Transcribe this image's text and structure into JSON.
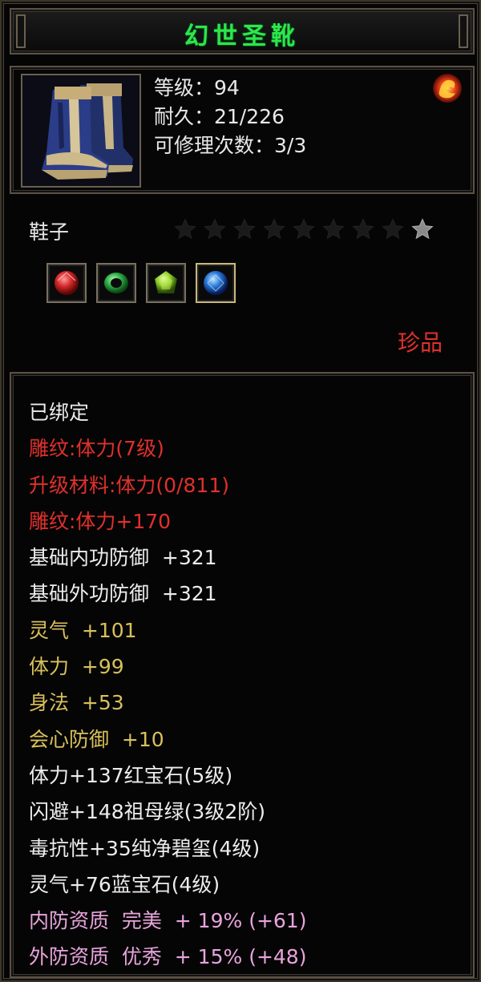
{
  "item": {
    "name": "幻世圣靴",
    "level_line": "等级：94",
    "durability_line": "耐久：21/226",
    "repair_line": "可修理次数：3/3",
    "type": "鞋子",
    "rarity": "珍品",
    "stars": {
      "total": 9,
      "lit": 1
    }
  },
  "gems": [
    {
      "name": "red-gem-icon",
      "color": "#d42a2a"
    },
    {
      "name": "emerald-ring-icon",
      "color": "#2fb24a"
    },
    {
      "name": "green-jade-icon",
      "color": "#8fd12a"
    },
    {
      "name": "blue-sapphire-icon",
      "color": "#2a7ad8"
    }
  ],
  "colors": {
    "title": "#2fe64a",
    "white": "#ececec",
    "red": "#e0302c",
    "gold": "#d8c05a",
    "pink": "#e8a4dc"
  },
  "stats": [
    {
      "text": "已绑定",
      "color": "#ececec"
    },
    {
      "text": "雕纹:体力(7级)",
      "color": "#e0302c"
    },
    {
      "text": "升级材料:体力(0/811)",
      "color": "#e0302c"
    },
    {
      "text": "雕纹:体力+170",
      "color": "#e0302c"
    },
    {
      "text": "基础内功防御  +321",
      "color": "#ececec"
    },
    {
      "text": "基础外功防御  +321",
      "color": "#ececec"
    },
    {
      "text": "灵气  +101",
      "color": "#d8c05a"
    },
    {
      "text": "体力  +99",
      "color": "#d8c05a"
    },
    {
      "text": "身法  +53",
      "color": "#d8c05a"
    },
    {
      "text": "会心防御  +10",
      "color": "#d8c05a"
    },
    {
      "text": "体力+137红宝石(5级)",
      "color": "#ececec"
    },
    {
      "text": "闪避+148祖母绿(3级2阶)",
      "color": "#ececec"
    },
    {
      "text": "毒抗性+35纯净碧玺(4级)",
      "color": "#ececec"
    },
    {
      "text": "灵气+76蓝宝石(4级)",
      "color": "#ececec"
    },
    {
      "text": "内防资质  完美  + 19% (+61)",
      "color": "#e8a4dc"
    },
    {
      "text": "外防资质  优秀  + 15% (+48)",
      "color": "#e8a4dc"
    }
  ]
}
